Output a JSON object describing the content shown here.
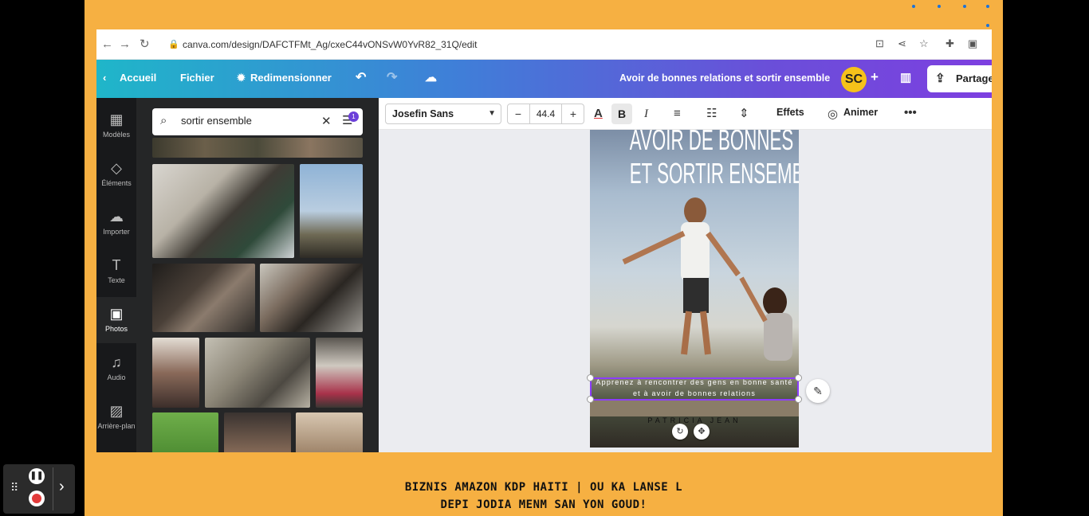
{
  "browser": {
    "url": "canva.com/design/DAFCTFMt_Ag/cxeC44vONSvW0YvR82_31Q/edit",
    "icons": [
      "back-icon",
      "forward-icon",
      "reload-icon",
      "lock-icon",
      "translate-icon",
      "share-icon",
      "star-icon",
      "extensions-icon",
      "sidepanel-icon"
    ]
  },
  "header": {
    "home_label": "Accueil",
    "file_label": "Fichier",
    "resize_label": "Redimensionner",
    "design_title": "Avoir de bonnes relations et sortir ensemble",
    "avatar_initials": "SC",
    "share_label": "Partager",
    "plus_label": "+"
  },
  "rail": {
    "items": [
      {
        "label": "Modèles",
        "icon": "templates-icon"
      },
      {
        "label": "Éléments",
        "icon": "elements-icon"
      },
      {
        "label": "Importer",
        "icon": "upload-icon"
      },
      {
        "label": "Texte",
        "icon": "text-icon"
      },
      {
        "label": "Photos",
        "icon": "photos-icon"
      },
      {
        "label": "Audio",
        "icon": "audio-icon"
      },
      {
        "label": "Arrière-plan",
        "icon": "background-icon"
      }
    ]
  },
  "search": {
    "value": "sortir ensemble",
    "filter_count": "1"
  },
  "toolbar": {
    "font": "Josefin Sans",
    "font_size": "44.4",
    "minus": "−",
    "plus": "+",
    "effects_label": "Effets",
    "animate_label": "Animer"
  },
  "canvas": {
    "title_line1": "AVOIR DE BONNES RELATIONS",
    "title_line2": "ET SORTIR ENSEMBLE",
    "subtitle_line1": "Apprenez à rencontrer des gens en bonne santé",
    "subtitle_line2": "et à avoir de bonnes relations",
    "author": "PATRICIA JEAN"
  },
  "caption": {
    "line1": "BIZNIS AMAZON KDP HAITI | OU KA LANSE L",
    "line2": "DEPI JODIA MENM SAN YON GOUD!"
  },
  "colors": {
    "frame": "#f6b042",
    "accent": "#8b3dff",
    "rail": "#18191b",
    "panel": "#252627"
  }
}
